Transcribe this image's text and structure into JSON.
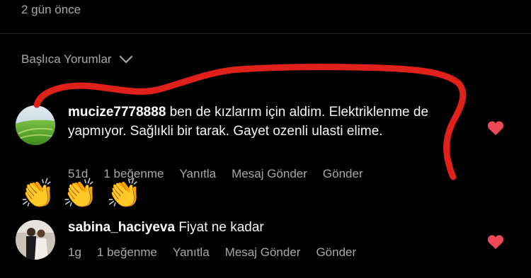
{
  "post": {
    "time_ago": "2 gün önce"
  },
  "filter": {
    "label": "Başlıca Yorumlar",
    "icon": "chevron-down-icon"
  },
  "comments": [
    {
      "username": "mucize7778888",
      "text": "ben de kızlarım için aldim. Elektriklenme de yapmıyor. Sağlıkli bir tarak. Gayet ozenli ulasti elime.",
      "time": "51d",
      "likes": "1 beğenme",
      "reply": "Yanıtla",
      "send_message": "Mesaj Gönder",
      "send": "Gönder",
      "liked": true,
      "avatar": "grass-field-avatar"
    },
    {
      "username": "sabina_haciyeva",
      "text": "Fiyat ne kadar",
      "time": "1g",
      "likes": "1 beğenme",
      "reply": "Yanıtla",
      "send_message": "Mesaj Gönder",
      "send": "Gönder",
      "liked": true,
      "avatar": "couple-photo-avatar"
    }
  ],
  "overlays": {
    "claps": [
      "👏",
      "👏",
      "👏"
    ],
    "scribble_color": "#e0201a"
  },
  "colors": {
    "heart": "#ed4956",
    "muted": "#a8a8a8",
    "background": "#000000"
  }
}
